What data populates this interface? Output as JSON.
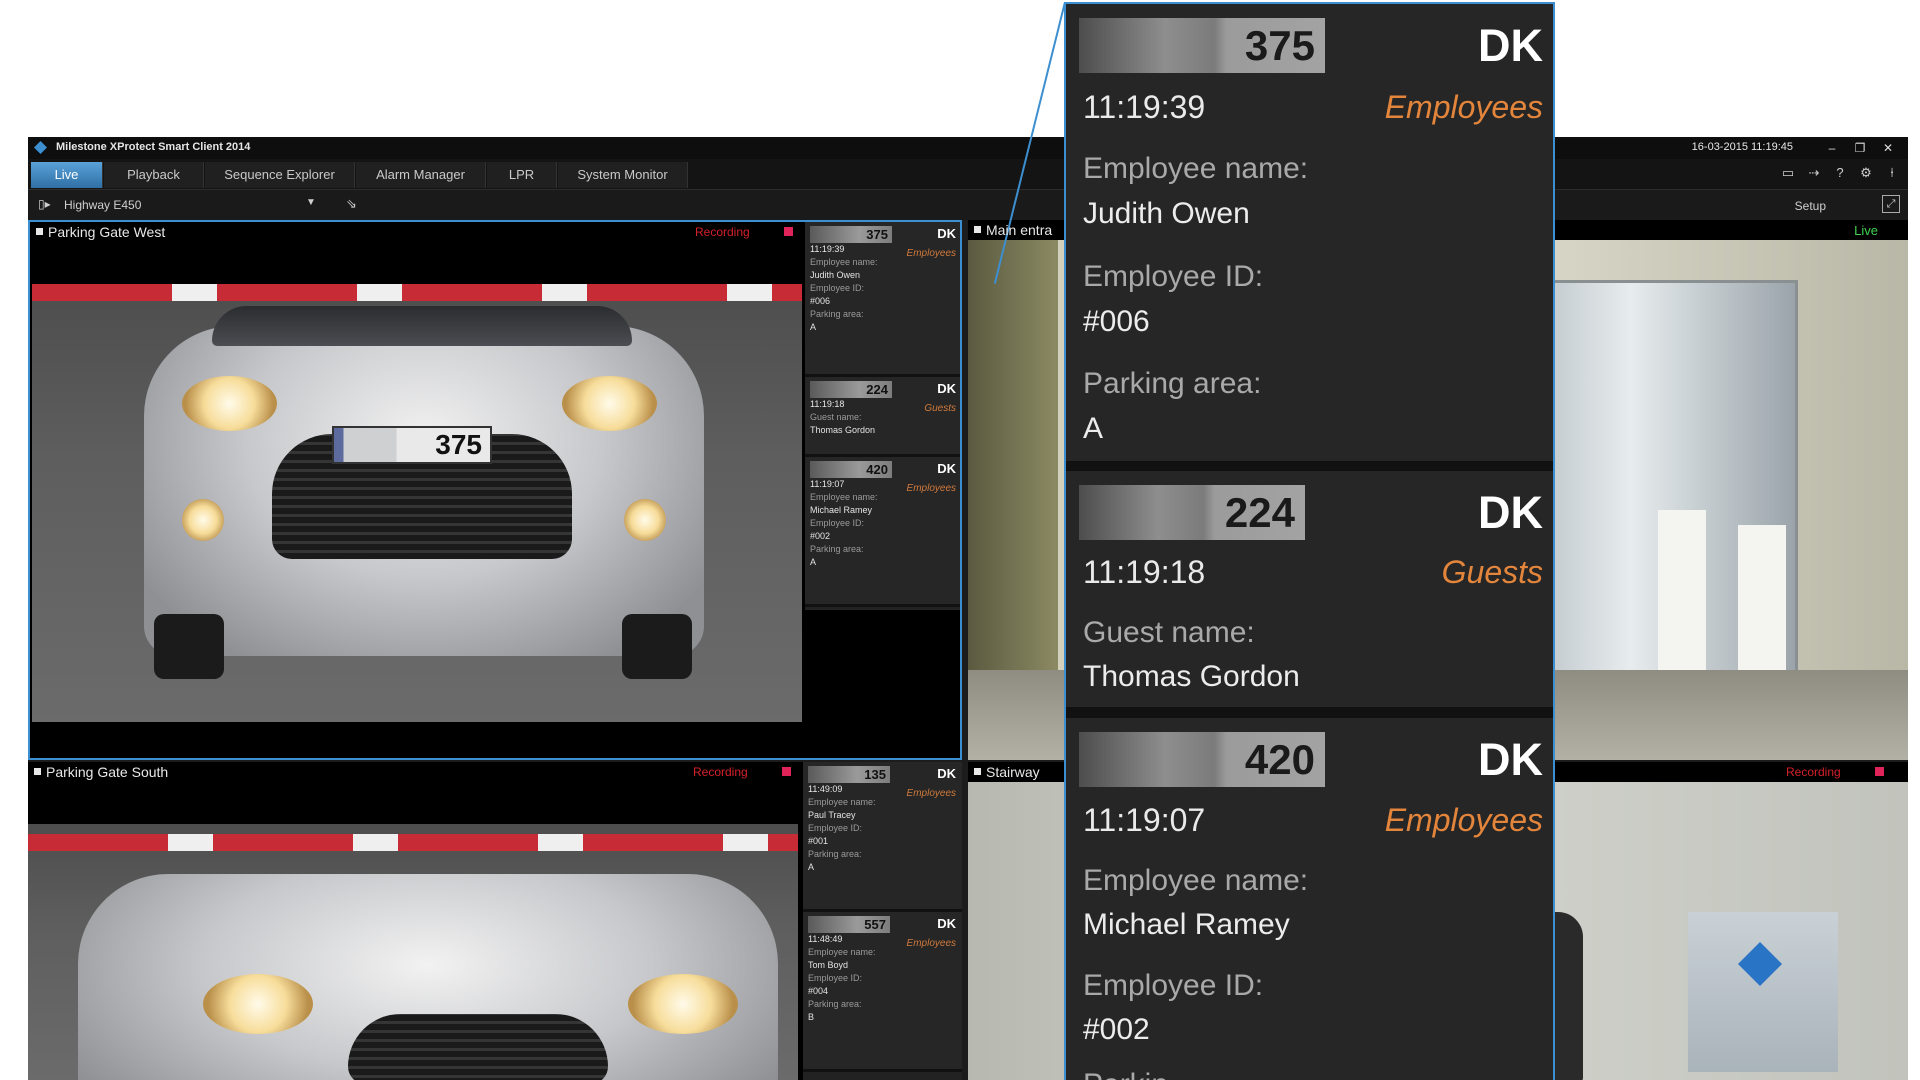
{
  "window": {
    "title": "Milestone XProtect Smart Client 2014",
    "clock": "16-03-2015 11:19:45",
    "win_buttons": [
      "–",
      "❐",
      "✕"
    ]
  },
  "tabs": [
    {
      "label": "Live",
      "active": true
    },
    {
      "label": "Playback",
      "active": false
    },
    {
      "label": "Sequence Explorer",
      "active": false
    },
    {
      "label": "Alarm Manager",
      "active": false
    },
    {
      "label": "LPR",
      "active": false
    },
    {
      "label": "System Monitor",
      "active": false
    }
  ],
  "view": {
    "name": "Highway E450",
    "setup_label": "Setup"
  },
  "cameras": {
    "gate_west": {
      "name": "Parking Gate West",
      "status": "Recording",
      "plate": "375"
    },
    "gate_south": {
      "name": "Parking Gate South",
      "status": "Recording"
    },
    "main_entrance": {
      "name": "Main entra",
      "status": "Live"
    },
    "stairway": {
      "name": "Stairway",
      "status": "Recording"
    }
  },
  "west_events": [
    {
      "plate": "375",
      "country": "DK",
      "time": "11:19:39",
      "group": "Employees",
      "f1_label": "Employee name:",
      "f1_value": "Judith Owen",
      "f2_label": "Employee ID:",
      "f2_value": "#006",
      "f3_label": "Parking area:",
      "f3_value": "A"
    },
    {
      "plate": "224",
      "country": "DK",
      "time": "11:19:18",
      "group": "Guests",
      "f1_label": "Guest name:",
      "f1_value": "Thomas Gordon"
    },
    {
      "plate": "420",
      "country": "DK",
      "time": "11:19:07",
      "group": "Employees",
      "f1_label": "Employee name:",
      "f1_value": "Michael Ramey",
      "f2_label": "Employee ID:",
      "f2_value": "#002",
      "f3_label": "Parking area:",
      "f3_value": "A"
    }
  ],
  "south_events": [
    {
      "plate": "135",
      "country": "DK",
      "time": "11:49:09",
      "group": "Employees",
      "f1_label": "Employee name:",
      "f1_value": "Paul Tracey",
      "f2_label": "Employee ID:",
      "f2_value": "#001",
      "f3_label": "Parking area:",
      "f3_value": "A"
    },
    {
      "plate": "557",
      "country": "DK",
      "time": "11:48:49",
      "group": "Employees",
      "f1_label": "Employee name:",
      "f1_value": "Tom Boyd",
      "f2_label": "Employee ID:",
      "f2_value": "#004",
      "f3_label": "Parking area:",
      "f3_value": "B"
    }
  ],
  "zoom": {
    "cards": [
      {
        "plate": "375",
        "country": "DK",
        "time": "11:19:39",
        "group": "Employees",
        "f1_label": "Employee name:",
        "f1_value": "Judith Owen",
        "f2_label": "Employee ID:",
        "f2_value": "#006",
        "f3_label": "Parking area:",
        "f3_value": "A"
      },
      {
        "plate": "224",
        "country": "DK",
        "time": "11:19:18",
        "group": "Guests",
        "f1_label": "Guest name:",
        "f1_value": "Thomas Gordon"
      },
      {
        "plate": "420",
        "country": "DK",
        "time": "11:19:07",
        "group": "Employees",
        "f1_label": "Employee name:",
        "f1_value": "Michael Ramey",
        "f2_label": "Employee ID:",
        "f2_value": "#002",
        "f3_label": "Parking area:",
        "f3_value": "Parkin"
      }
    ]
  },
  "icons": {
    "logo": "milestone-diamond-icon",
    "view_selector": "view-icon",
    "view_dropdown": "chevron-down-icon",
    "view_link": "link-icon",
    "fullscreen": "fullscreen-icon",
    "toolbar": [
      "monitor-icon",
      "export-icon",
      "help-icon",
      "gear-icon",
      "pin-icon"
    ]
  },
  "colors": {
    "accent": "#3c8fd0",
    "recording": "#d4202a",
    "live": "#3fd24f",
    "group_label": "#e4853c",
    "background": "#1c1c1c"
  }
}
